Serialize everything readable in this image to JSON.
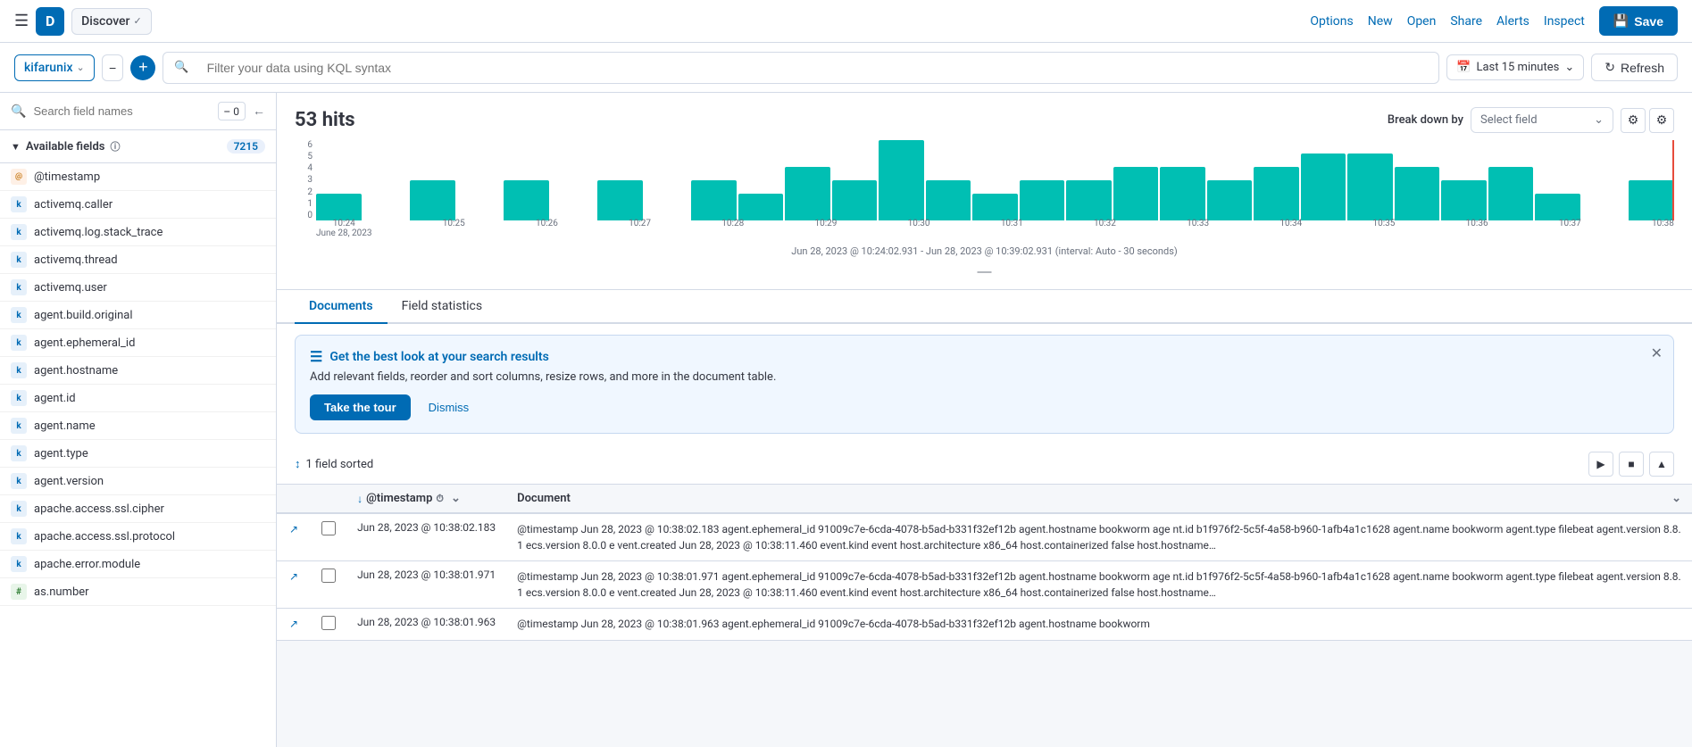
{
  "topNav": {
    "appBadge": "D",
    "appName": "Discover",
    "links": [
      "Options",
      "New",
      "Open",
      "Share",
      "Alerts",
      "Inspect"
    ],
    "saveLabel": "Save"
  },
  "filterBar": {
    "dataSource": "kifarunix",
    "kqlPlaceholder": "Filter your data using KQL syntax",
    "timePicker": "Last 15 minutes",
    "refreshLabel": "Refresh"
  },
  "sidebar": {
    "searchPlaceholder": "Search field names",
    "filterCount": "0",
    "availableFieldsLabel": "Available fields",
    "fieldsCount": "7215",
    "fields": [
      {
        "badge": "at",
        "name": "@timestamp"
      },
      {
        "badge": "k",
        "name": "activemq.caller"
      },
      {
        "badge": "k",
        "name": "activemq.log.stack_trace"
      },
      {
        "badge": "k",
        "name": "activemq.thread"
      },
      {
        "badge": "k",
        "name": "activemq.user"
      },
      {
        "badge": "k",
        "name": "agent.build.original"
      },
      {
        "badge": "k",
        "name": "agent.ephemeral_id"
      },
      {
        "badge": "k",
        "name": "agent.hostname"
      },
      {
        "badge": "k",
        "name": "agent.id"
      },
      {
        "badge": "k",
        "name": "agent.name"
      },
      {
        "badge": "k",
        "name": "agent.type"
      },
      {
        "badge": "k",
        "name": "agent.version"
      },
      {
        "badge": "k",
        "name": "apache.access.ssl.cipher"
      },
      {
        "badge": "k",
        "name": "apache.access.ssl.protocol"
      },
      {
        "badge": "k",
        "name": "apache.error.module"
      },
      {
        "badge": "#",
        "name": "as.number"
      }
    ]
  },
  "histogram": {
    "hits": "53 hits",
    "breakdownLabel": "Break down by",
    "breakdownPlaceholder": "Select field",
    "bars": [
      2,
      0,
      3,
      0,
      3,
      0,
      3,
      0,
      3,
      2,
      4,
      3,
      6,
      3,
      2,
      3,
      3,
      4,
      4,
      3,
      4,
      5,
      5,
      4,
      3,
      4,
      2,
      0,
      3
    ],
    "xLabels": [
      "10:24\nJune 28, 2023",
      "10:25",
      "10:26",
      "10:27",
      "10:28",
      "10:29",
      "10:30",
      "10:31",
      "10:32",
      "10:33",
      "10:34",
      "10:35",
      "10:36",
      "10:37",
      "10:38"
    ],
    "rangeLabel": "Jun 28, 2023 @ 10:24:02.931 - Jun 28, 2023 @ 10:39:02.931 (interval: Auto - 30 seconds)",
    "yLabels": [
      "6",
      "5",
      "4",
      "3",
      "2",
      "1",
      "0"
    ]
  },
  "tabs": [
    {
      "id": "documents",
      "label": "Documents",
      "active": true
    },
    {
      "id": "fieldstatistics",
      "label": "Field statistics",
      "active": false
    }
  ],
  "tourBanner": {
    "title": "Get the best look at your search results",
    "description": "Add relevant fields, reorder and sort columns, resize rows, and more in the document table.",
    "tourBtnLabel": "Take the tour",
    "dismissLabel": "Dismiss"
  },
  "table": {
    "sortInfo": "1 field sorted",
    "sortIcon": "↕",
    "cols": {
      "timestamp": "@timestamp",
      "document": "Document"
    },
    "rows": [
      {
        "timestamp": "Jun 28, 2023 @ 10:38:02.183",
        "doc": "@timestamp Jun 28, 2023 @ 10:38:02.183 agent.ephemeral_id 91009c7e-6cda-4078-b5ad-b331f32ef12b agent.hostname bookworm age nt.id b1f976f2-5c5f-4a58-b960-1afb4a1c1628 agent.name bookworm agent.type filebeat agent.version 8.8.1 ecs.version 8.0.0 e vent.created Jun 28, 2023 @ 10:38:11.460 event.kind event host.architecture x86_64 host.containerized false host.hostname…"
      },
      {
        "timestamp": "Jun 28, 2023 @ 10:38:01.971",
        "doc": "@timestamp Jun 28, 2023 @ 10:38:01.971 agent.ephemeral_id 91009c7e-6cda-4078-b5ad-b331f32ef12b agent.hostname bookworm age nt.id b1f976f2-5c5f-4a58-b960-1afb4a1c1628 agent.name bookworm agent.type filebeat agent.version 8.8.1 ecs.version 8.0.0 e vent.created Jun 28, 2023 @ 10:38:11.460 event.kind event host.architecture x86_64 host.containerized false host.hostname…"
      },
      {
        "timestamp": "Jun 28, 2023 @ 10:38:01.963",
        "doc": "@timestamp Jun 28, 2023 @ 10:38:01.963 agent.ephemeral_id 91009c7e-6cda-4078-b5ad-b331f32ef12b agent.hostname bookworm"
      }
    ]
  }
}
